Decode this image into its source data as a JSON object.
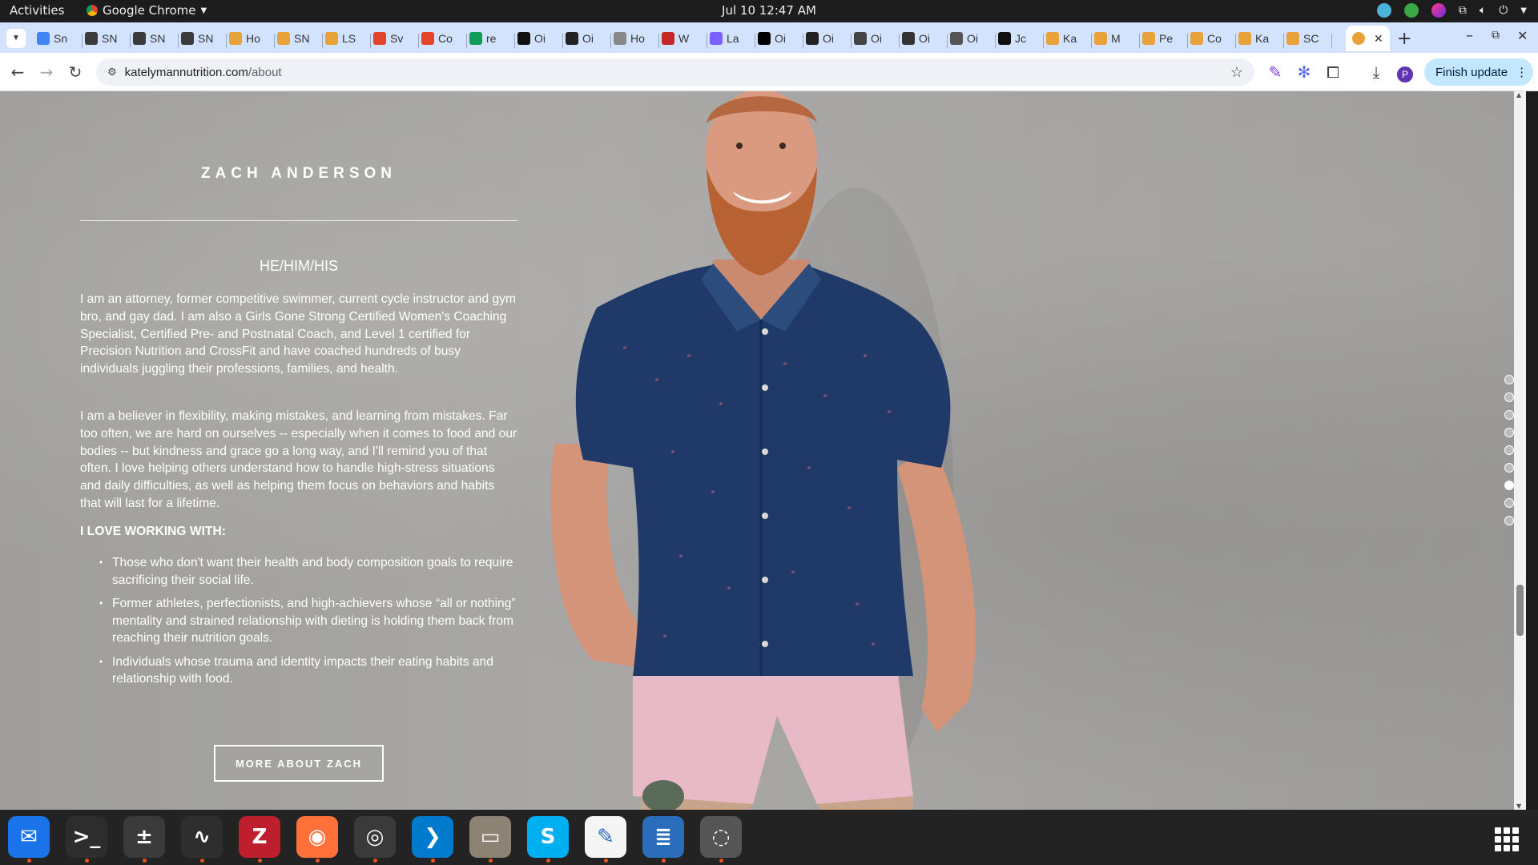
{
  "topbar": {
    "activities": "Activities",
    "app_name": "Google Chrome",
    "clock": "Jul 10  12:47 AM"
  },
  "tabs": [
    {
      "label": "Sn",
      "color": "#4285f4"
    },
    {
      "label": "SN",
      "color": "#3b3b3b"
    },
    {
      "label": "SN",
      "color": "#3b3b3b"
    },
    {
      "label": "SN",
      "color": "#3b3b3b"
    },
    {
      "label": "Ho",
      "color": "#e8a23a"
    },
    {
      "label": "SN",
      "color": "#e8a23a"
    },
    {
      "label": "LS",
      "color": "#e8a23a"
    },
    {
      "label": "Sv",
      "color": "#e24329"
    },
    {
      "label": "Co",
      "color": "#e24329"
    },
    {
      "label": "re",
      "color": "#0f9d58"
    },
    {
      "label": "Oi",
      "color": "#111111"
    },
    {
      "label": "Oi",
      "color": "#222222"
    },
    {
      "label": "Ho",
      "color": "#888888"
    },
    {
      "label": "W",
      "color": "#c62828"
    },
    {
      "label": "La",
      "color": "#7b61ff"
    },
    {
      "label": "Oi",
      "color": "#000000"
    },
    {
      "label": "Oi",
      "color": "#222222"
    },
    {
      "label": "Oi",
      "color": "#444444"
    },
    {
      "label": "Oi",
      "color": "#333333"
    },
    {
      "label": "Oi",
      "color": "#555555"
    },
    {
      "label": "Jc",
      "color": "#111111"
    },
    {
      "label": "Ka",
      "color": "#e8a23a"
    },
    {
      "label": "M",
      "color": "#e8a23a"
    },
    {
      "label": "Pe",
      "color": "#e8a23a"
    },
    {
      "label": "Co",
      "color": "#e8a23a"
    },
    {
      "label": "Ka",
      "color": "#e8a23a"
    },
    {
      "label": "SC",
      "color": "#e8a23a"
    }
  ],
  "toolbar": {
    "url_domain": "katelymannutrition.com",
    "url_path": "/about",
    "finish_update": "Finish update"
  },
  "profile": {
    "name": "ZACH ANDERSON",
    "pronouns": "HE/HIM/HIS",
    "para1": "I am an attorney, former competitive swimmer, current cycle instructor and gym bro, and gay dad. I am also a Girls Gone Strong Certified Women's Coaching Specialist, Certified Pre- and Postnatal Coach, and Level 1 certified for Precision Nutrition and CrossFit and have coached hundreds of busy individuals juggling their professions, families, and health.",
    "para2": "I am a believer in flexibility, making mistakes, and learning from mistakes. Far too often, we are hard on ourselves -- especially when it comes to food and our bodies -- but kindness and grace go a long way, and I'll remind you of that often. I love helping others understand how to handle high-stress situations and daily difficulties, as well as helping them focus on behaviors and habits that will last for a lifetime.",
    "love_heading": "I LOVE WORKING WITH:",
    "love_items": [
      "Those who don't want their health and body composition goals to require sacrificing their social life.",
      "Former athletes, perfectionists, and high-achievers whose “all or nothing” mentality and strained relationship with dieting is holding them back from reaching their nutrition goals.",
      "Individuals whose trauma and identity impacts their eating habits and relationship with food."
    ],
    "more_button": "MORE ABOUT ZACH"
  },
  "section_dots": {
    "count": 9,
    "active_index": 6
  },
  "dock": [
    {
      "name": "thunderbird",
      "color": "#1a73e8",
      "glyph": "✉"
    },
    {
      "name": "terminal",
      "color": "#2d2d2d",
      "glyph": ">_"
    },
    {
      "name": "calculator",
      "color": "#3a3a3a",
      "glyph": "±"
    },
    {
      "name": "system-monitor",
      "color": "#2e2e2e",
      "glyph": "∿"
    },
    {
      "name": "filezilla",
      "color": "#bf1e2d",
      "glyph": "Z"
    },
    {
      "name": "firefox",
      "color": "#ff7139",
      "glyph": "◉"
    },
    {
      "name": "chrome",
      "color": "#3a3a3a",
      "glyph": "◎"
    },
    {
      "name": "vscode",
      "color": "#007acc",
      "glyph": "❯"
    },
    {
      "name": "files",
      "color": "#8d8375",
      "glyph": "▭"
    },
    {
      "name": "skype",
      "color": "#00aff0",
      "glyph": "S"
    },
    {
      "name": "text-editor",
      "color": "#f5f5f5",
      "glyph": "✎"
    },
    {
      "name": "libreoffice-writer",
      "color": "#2a6ebb",
      "glyph": "≣"
    },
    {
      "name": "disks",
      "color": "#555555",
      "glyph": "◌"
    }
  ]
}
